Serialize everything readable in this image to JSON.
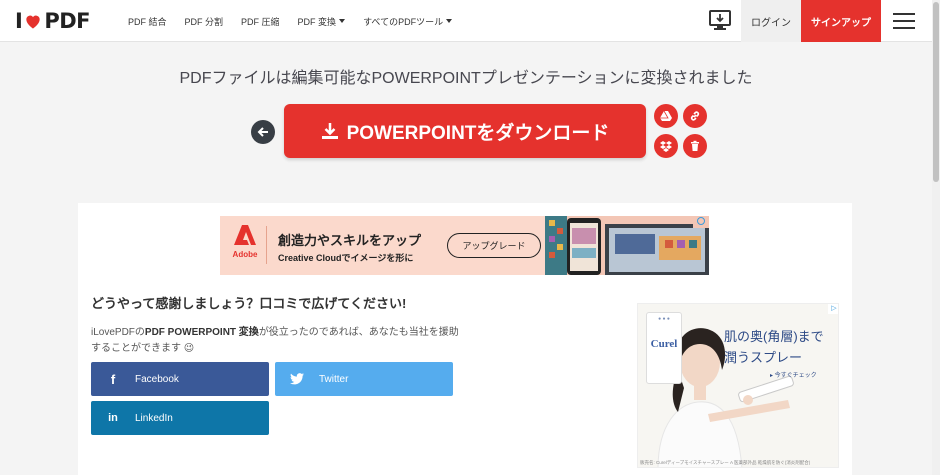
{
  "header": {
    "logo_left": "I",
    "logo_right": "PDF",
    "nav": [
      {
        "label": "PDF 結合",
        "dropdown": false
      },
      {
        "label": "PDF 分割",
        "dropdown": false
      },
      {
        "label": "PDF 圧縮",
        "dropdown": false
      },
      {
        "label": "PDF 変換",
        "dropdown": true
      },
      {
        "label": "すべてのPDFツール",
        "dropdown": true
      }
    ],
    "login_label": "ログイン",
    "signup_label": "サインアップ"
  },
  "main": {
    "title": "PDFファイルは編集可能なPOWERPOINTプレゼンテーションに変換されました",
    "download_label": "POWERPOINTをダウンロード"
  },
  "ad_banner": {
    "brand": "Adobe",
    "headline": "創造力やスキルをアップ",
    "subline": "Creative Cloudでイメージを形に",
    "cta": "アップグレード"
  },
  "share": {
    "title": "どうやって感謝しましょう？口コミで広げてください!",
    "desc_prefix": "iLovePDFの",
    "desc_bold": "PDF POWERPOINT 変換",
    "desc_suffix": "が役立ったのであれば、あなたも当社を援助することができます 😉",
    "facebook": "Facebook",
    "twitter": "Twitter",
    "linkedin": "LinkedIn"
  },
  "side_ad": {
    "brand": "Curel",
    "headline": "肌の奥(角層)まで潤うスプレー",
    "cta": "▸ 今すぐチェック",
    "footer": "販売名: Curelディープモイスチャースプレー A  医薬部外品  乾燥肌を防ぐ(消炎剤配合)"
  },
  "colors": {
    "brand_red": "#e5322d",
    "facebook": "#3a5998",
    "twitter": "#55acee",
    "linkedin": "#0e76a8"
  }
}
